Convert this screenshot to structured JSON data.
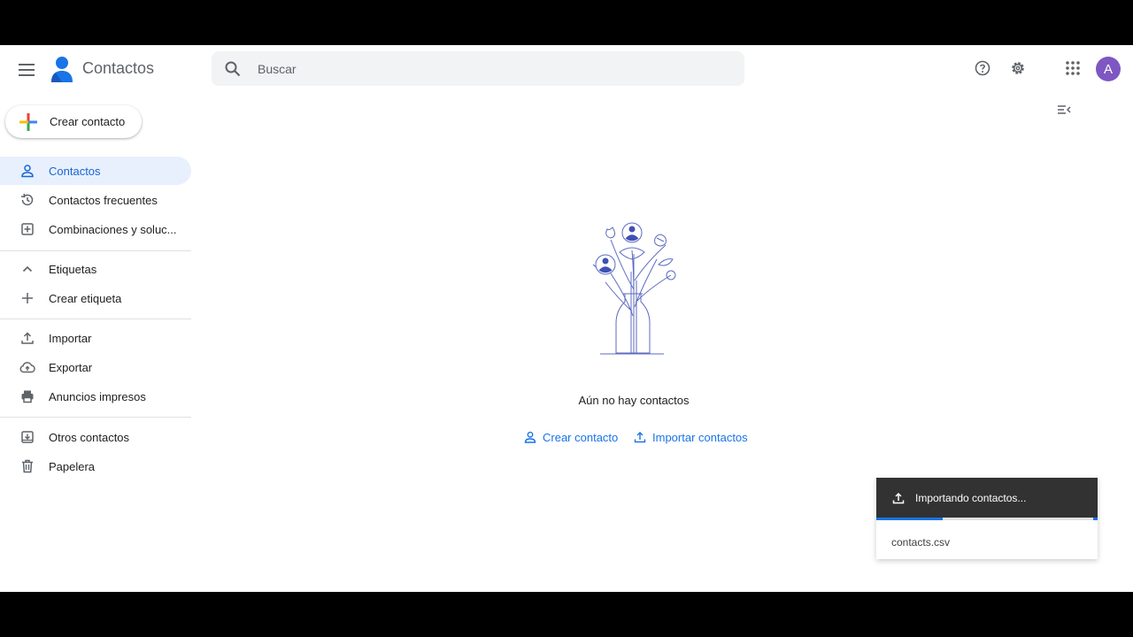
{
  "header": {
    "app_title": "Contactos",
    "search_placeholder": "Buscar",
    "avatar_letter": "A"
  },
  "sidebar": {
    "create_label": "Crear contacto",
    "items": [
      {
        "label": "Contactos",
        "icon": "person-icon",
        "active": true
      },
      {
        "label": "Contactos frecuentes",
        "icon": "history-icon"
      },
      {
        "label": "Combinaciones y soluc...",
        "icon": "merge-icon"
      }
    ],
    "labels_section": {
      "label": "Etiquetas",
      "icon": "chevron-up-icon"
    },
    "create_label_item": {
      "label": "Crear etiqueta",
      "icon": "plus-icon"
    },
    "tools": [
      {
        "label": "Importar",
        "icon": "upload-icon"
      },
      {
        "label": "Exportar",
        "icon": "cloud-upload-icon"
      },
      {
        "label": "Anuncios impresos",
        "icon": "printer-icon"
      }
    ],
    "other": [
      {
        "label": "Otros contactos",
        "icon": "archive-icon"
      },
      {
        "label": "Papelera",
        "icon": "trash-icon"
      }
    ]
  },
  "main": {
    "empty_text": "Aún no hay contactos",
    "create_link": "Crear contacto",
    "import_link": "Importar contactos"
  },
  "toast": {
    "title": "Importando contactos...",
    "file": "contacts.csv",
    "progress": 0.3
  },
  "colors": {
    "accent": "#1a73e8",
    "active_bg": "#e8f0fe",
    "avatar": "#7e57c2",
    "toast_bg": "#323232"
  }
}
